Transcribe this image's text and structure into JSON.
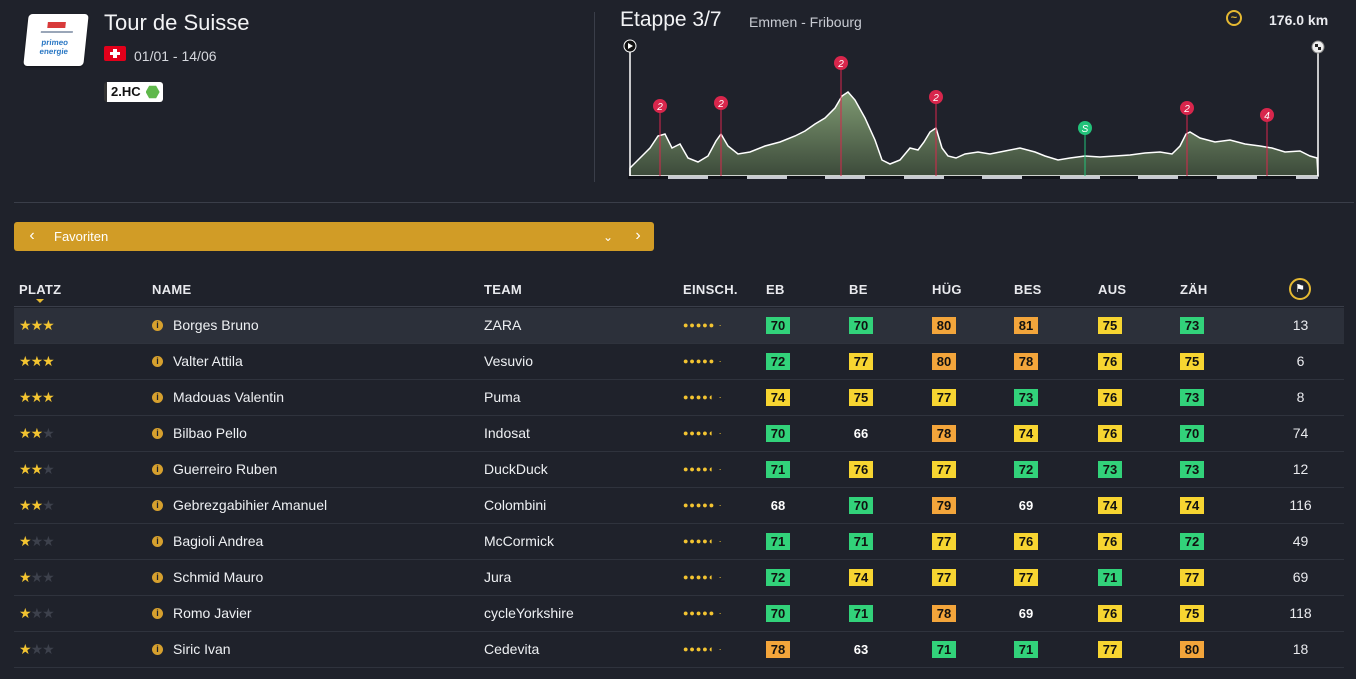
{
  "race": {
    "title": "Tour de Suisse",
    "dates": "01/01 - 14/06",
    "category": "2.HC",
    "logo_text": "primeo energie"
  },
  "stage": {
    "label": "Etappe 3/7",
    "route": "Emmen - Fribourg",
    "distance": "176.0 km"
  },
  "profile": {
    "markers": [
      {
        "label": "2",
        "type": "climb",
        "color": "#d8264c"
      },
      {
        "label": "2",
        "type": "climb",
        "color": "#d8264c"
      },
      {
        "label": "2",
        "type": "climb",
        "color": "#d8264c"
      },
      {
        "label": "2",
        "type": "climb",
        "color": "#d8264c"
      },
      {
        "label": "S",
        "type": "sprint",
        "color": "#22c37a"
      },
      {
        "label": "2",
        "type": "climb",
        "color": "#d8264c"
      },
      {
        "label": "4",
        "type": "climb",
        "color": "#d8264c"
      }
    ],
    "start_icon": "play-icon",
    "finish_icon": "checkered-flag-icon"
  },
  "selector": {
    "label": "Favoriten",
    "prev_icon": "chevron-left-icon",
    "dropdown_icon": "chevron-down-icon",
    "next_icon": "chevron-right-icon"
  },
  "table": {
    "headers": {
      "platz": "PLATZ",
      "name": "NAME",
      "team": "TEAM",
      "einsch": "EINSCH.",
      "eb": "EB",
      "be": "BE",
      "hug": "HÜG",
      "bes": "BES",
      "aus": "AUS",
      "zah": "ZÄH",
      "points_icon": "rider-points-icon"
    },
    "colors": {
      "green": "#32d27a",
      "yellow": "#f7d531",
      "orange": "#f3a53b",
      "accent": "#d19c26"
    },
    "rows": [
      {
        "stars": 3,
        "name": "Borges Bruno",
        "team": "ZARA",
        "form": "●●●●● ·",
        "eb": "70",
        "be": "70",
        "hug": "80",
        "bes": "81",
        "aus": "75",
        "zah": "73",
        "pts": "13"
      },
      {
        "stars": 3,
        "name": "Valter Attila",
        "team": "Vesuvio",
        "form": "●●●●● ·",
        "eb": "72",
        "be": "77",
        "hug": "80",
        "bes": "78",
        "aus": "76",
        "zah": "75",
        "pts": "6"
      },
      {
        "stars": 3,
        "name": "Madouas Valentin",
        "team": "Puma",
        "form": "●●●●◐ ·",
        "eb": "74",
        "be": "75",
        "hug": "77",
        "bes": "73",
        "aus": "76",
        "zah": "73",
        "pts": "8"
      },
      {
        "stars": 2,
        "name": "Bilbao Pello",
        "team": "Indosat",
        "form": "●●●●◐ ·",
        "eb": "70",
        "be": "66",
        "hug": "78",
        "bes": "74",
        "aus": "76",
        "zah": "70",
        "pts": "74"
      },
      {
        "stars": 2,
        "name": "Guerreiro Ruben",
        "team": "DuckDuck",
        "form": "●●●●◐ ·",
        "eb": "71",
        "be": "76",
        "hug": "77",
        "bes": "72",
        "aus": "73",
        "zah": "73",
        "pts": "12"
      },
      {
        "stars": 2,
        "name": "Gebrezgabihier Amanuel",
        "team": "Colombini",
        "form": "●●●●● ·",
        "eb": "68",
        "be": "70",
        "hug": "79",
        "bes": "69",
        "aus": "74",
        "zah": "74",
        "pts": "116"
      },
      {
        "stars": 1,
        "name": "Bagioli Andrea",
        "team": "McCormick",
        "form": "●●●●◐ ·",
        "eb": "71",
        "be": "71",
        "hug": "77",
        "bes": "76",
        "aus": "76",
        "zah": "72",
        "pts": "49"
      },
      {
        "stars": 1,
        "name": "Schmid Mauro",
        "team": "Jura",
        "form": "●●●●◐ ·",
        "eb": "72",
        "be": "74",
        "hug": "77",
        "bes": "77",
        "aus": "71",
        "zah": "77",
        "pts": "69"
      },
      {
        "stars": 1,
        "name": "Romo Javier",
        "team": "cycleYorkshire",
        "form": "●●●●● ·",
        "eb": "70",
        "be": "71",
        "hug": "78",
        "bes": "69",
        "aus": "76",
        "zah": "75",
        "pts": "118"
      },
      {
        "stars": 1,
        "name": "Siric Ivan",
        "team": "Cedevita",
        "form": "●●●●◐ ·",
        "eb": "78",
        "be": "63",
        "hug": "71",
        "bes": "71",
        "aus": "77",
        "zah": "80",
        "pts": "18"
      }
    ]
  }
}
